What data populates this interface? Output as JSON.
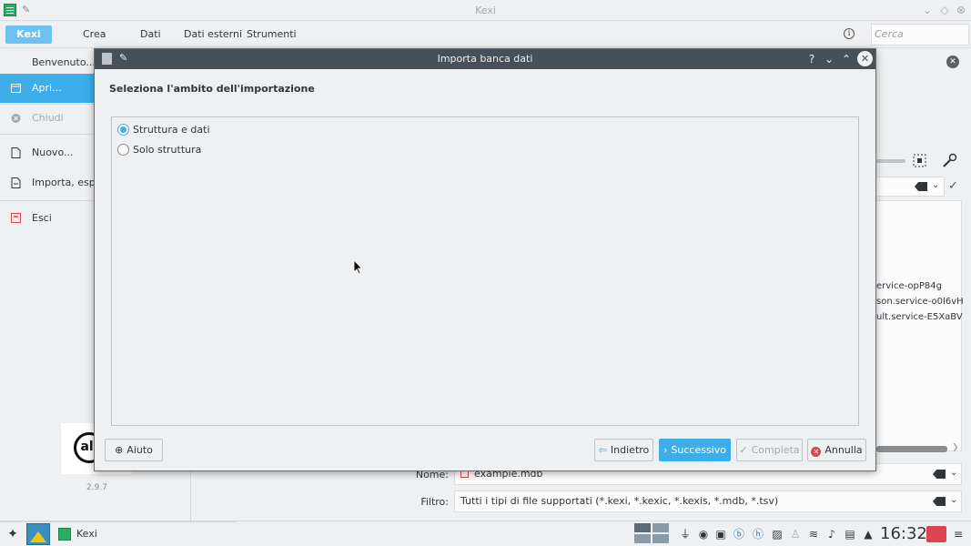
{
  "window": {
    "title": "Kexi"
  },
  "tabs": [
    "Kexi",
    "Crea",
    "Dati",
    "Dati esterni",
    "Strumenti"
  ],
  "search": {
    "placeholder": "Cerca"
  },
  "sidebar": {
    "items": [
      {
        "label": "Benvenuto...",
        "icon": "none"
      },
      {
        "label": "Apri...",
        "icon": "folder-icon"
      },
      {
        "label": "Chiudi",
        "icon": "close-circle-icon"
      },
      {
        "label": "Nuovo...",
        "icon": "new-document-icon"
      },
      {
        "label": "Importa, espo",
        "icon": "import-icon"
      },
      {
        "label": "Esci",
        "icon": "exit-icon"
      }
    ],
    "logo_text": "all",
    "version": "2.9.7"
  },
  "background": {
    "list_items": [
      "ervice-opP84g",
      "son.service-o0I6vH",
      "ult.service-E5XaBV"
    ],
    "name_label": "Nome:",
    "name_value": "example.mdb",
    "filter_label": "Filtro:",
    "filter_value": "Tutti i tipi di file supportati (*.kexi, *.kexic, *.kexis, *.mdb, *.tsv)"
  },
  "dialog": {
    "title": "Importa banca dati",
    "heading": "Seleziona l'ambito dell'importazione",
    "options": [
      {
        "label": "Struttura e dati",
        "checked": true
      },
      {
        "label": "Solo struttura",
        "checked": false
      }
    ],
    "buttons": {
      "help": "Aiuto",
      "back": "Indietro",
      "next": "Successivo",
      "finish": "Completa",
      "cancel": "Annulla"
    }
  },
  "taskbar": {
    "task_label": "Kexi",
    "clock": "16:32"
  },
  "colors": {
    "accent": "#3daee9",
    "dialog_titlebar": "#475057",
    "cancel_red": "#da4453"
  }
}
